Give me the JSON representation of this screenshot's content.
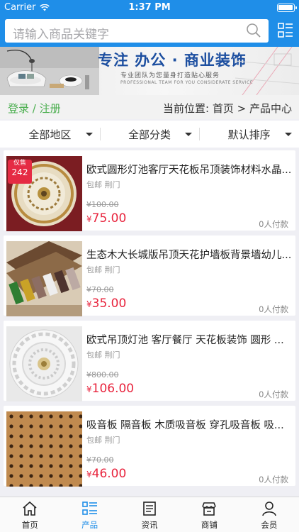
{
  "status_bar": {
    "carrier": "Carrier",
    "time": "1:37 PM"
  },
  "search": {
    "placeholder": "请输入商品关键字"
  },
  "banner": {
    "headline": "专注 办公 · 商业装饰",
    "subtitle": "专业团队为您量身打造贴心服务",
    "subtitle_en": "PROFESSIONAL TEAM FOR YOU CONSIDERATE SERVICE"
  },
  "crumb": {
    "login": "登录 / 注册",
    "location_label": "当前位置:",
    "path": "首页 > 产品中心"
  },
  "filters": [
    {
      "label": "全部地区"
    },
    {
      "label": "全部分类"
    },
    {
      "label": "默认排序"
    }
  ],
  "products": [
    {
      "title": "欧式圆形灯池客厅天花板吊顶装饰材料水晶...",
      "shipping": "包邮 荆门",
      "old_price": "¥100.00",
      "price_symbol": "¥",
      "price": "75.00",
      "paid": "0人付款",
      "badge": {
        "text": "仅售",
        "num": "242"
      }
    },
    {
      "title": "生态木大长城版吊顶天花护墙板背景墙幼儿...",
      "shipping": "包邮 荆门",
      "old_price": "¥70.00",
      "price_symbol": "¥",
      "price": "35.00",
      "paid": "0人付款"
    },
    {
      "title": "欧式吊顶灯池 客厅餐厅 天花板装饰 圆形 ...",
      "shipping": "包邮 荆门",
      "old_price": "¥800.00",
      "price_symbol": "¥",
      "price": "106.00",
      "paid": "0人付款"
    },
    {
      "title": "吸音板 隔音板 木质吸音板 穿孔吸音板 吸...",
      "shipping": "包邮 荆门",
      "old_price": "¥70.00",
      "price_symbol": "¥",
      "price": "46.00",
      "paid": "0人付款"
    }
  ],
  "tabbar": [
    {
      "label": "首页",
      "icon": "home-icon"
    },
    {
      "label": "产品",
      "icon": "list-icon",
      "active": true
    },
    {
      "label": "资讯",
      "icon": "news-icon"
    },
    {
      "label": "商铺",
      "icon": "shop-icon"
    },
    {
      "label": "会员",
      "icon": "member-icon"
    }
  ],
  "colors": {
    "brand": "#1f8ee8",
    "price": "#e8243d",
    "login": "#4caf50"
  }
}
